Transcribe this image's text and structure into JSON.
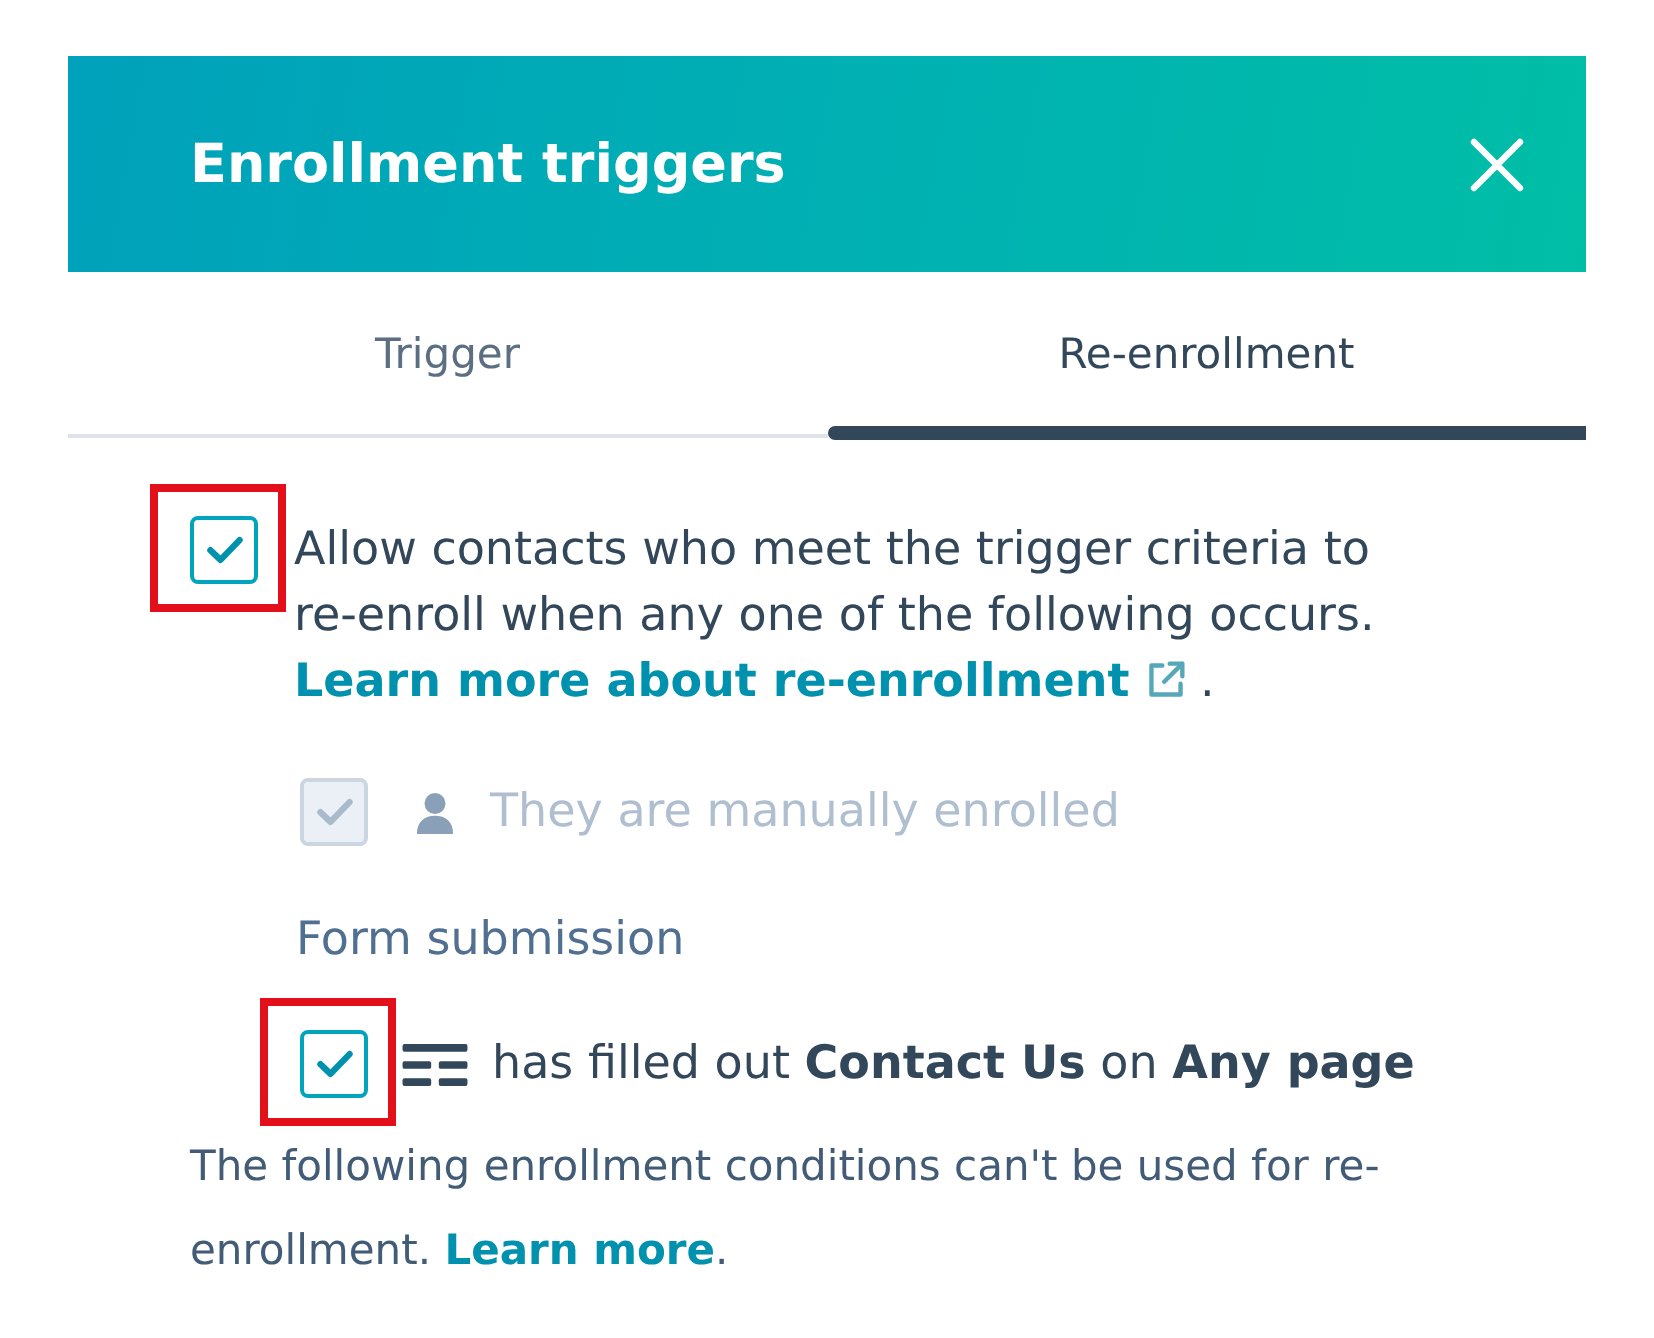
{
  "panel": {
    "title": "Enrollment triggers"
  },
  "tabs": [
    {
      "label": "Trigger",
      "selected": false
    },
    {
      "label": "Re-enrollment",
      "selected": true
    }
  ],
  "reenroll_option": {
    "checked": true,
    "highlighted": true,
    "text": "Allow contacts who meet the trigger criteria to re-enroll when any one of the following occurs.",
    "link": "Learn more about re-enrollment",
    "link_suffix": "."
  },
  "triggers": [
    {
      "kind": "manual",
      "checked": true,
      "disabled": true,
      "highlighted": false,
      "text": "They are manually enrolled"
    },
    {
      "kind": "heading",
      "text": "Form submission"
    },
    {
      "kind": "form",
      "checked": true,
      "disabled": false,
      "highlighted": true,
      "text": "has filled out **Contact Us** on **Any page**"
    }
  ],
  "note": {
    "text": "The following enrollment conditions can't be used for re-enrollment.",
    "link": "Learn more",
    "link_suffix": "."
  }
}
